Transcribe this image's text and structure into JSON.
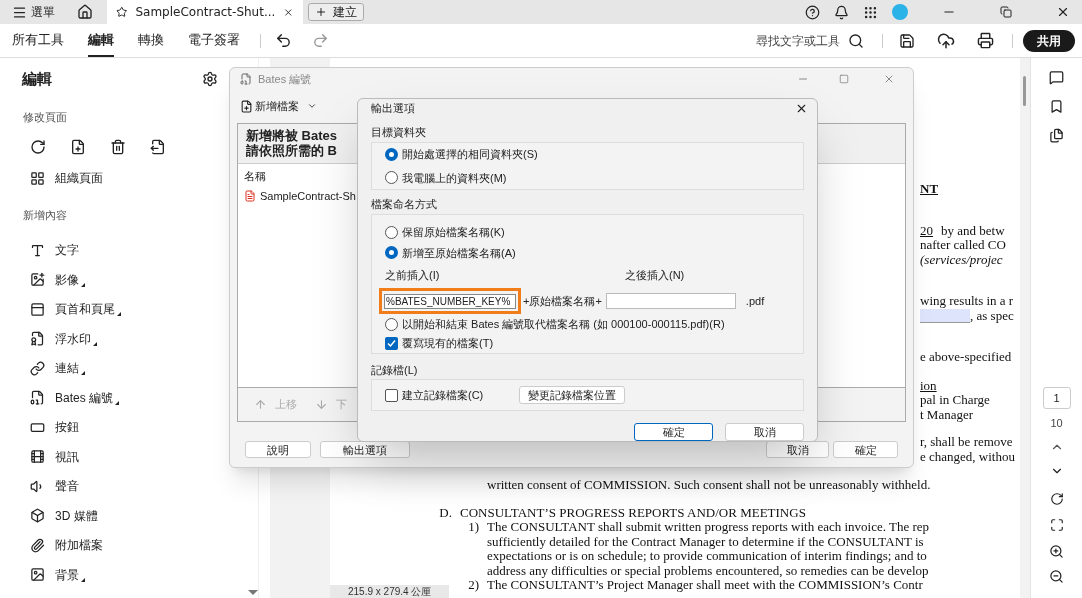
{
  "app_bar": {
    "menu": "選單",
    "tab_title": "SampleContract-Shut...",
    "create": "建立"
  },
  "toolbar": {
    "tabs": [
      {
        "label": "所有工具",
        "selected": false
      },
      {
        "label": "編輯",
        "selected": true
      },
      {
        "label": "轉換",
        "selected": false
      },
      {
        "label": "電子簽署",
        "selected": false
      }
    ],
    "search": "尋找文字或工具",
    "share": "共用"
  },
  "left_panel": {
    "title": "編輯",
    "modify_heading": "修改頁面",
    "organize": "組織頁面",
    "add_heading": "新增內容",
    "items": [
      {
        "label": "文字",
        "has_menu": false
      },
      {
        "label": "影像",
        "has_menu": true
      },
      {
        "label": "頁首和頁尾",
        "has_menu": true
      },
      {
        "label": "浮水印",
        "has_menu": true
      },
      {
        "label": "連結",
        "has_menu": true
      },
      {
        "label": "Bates 編號",
        "has_menu": true
      },
      {
        "label": "按鈕",
        "has_menu": false
      },
      {
        "label": "視訊",
        "has_menu": false
      },
      {
        "label": "聲音",
        "has_menu": false
      },
      {
        "label": "3D 媒體",
        "has_menu": false
      },
      {
        "label": "附加檔案",
        "has_menu": false
      },
      {
        "label": "背景",
        "has_menu": true
      }
    ]
  },
  "document": {
    "fragments": [
      [
        {
          "text": "NT",
          "kind": "heading"
        }
      ],
      [
        {
          "text": "20",
          "kind": "underline"
        },
        {
          "text": "by and betw",
          "kind": "plain"
        }
      ],
      [
        {
          "text": "nafter called CO",
          "kind": "plain"
        }
      ],
      [
        {
          "text": "(services/projec",
          "kind": "italic"
        }
      ],
      [
        {
          "text": "wing results in a r",
          "kind": "plain"
        }
      ],
      [
        {
          "text": ", as spec",
          "kind": "field"
        }
      ],
      [
        {
          "text": "e above-specified",
          "kind": "plain"
        }
      ],
      [
        {
          "text": "ion",
          "kind": "underline"
        }
      ],
      [
        {
          "text": "pal in Charge",
          "kind": "plain"
        }
      ],
      [
        {
          "text": "t Manager",
          "kind": "plain"
        }
      ],
      [
        {
          "text": "r, shall be remove",
          "kind": "plain"
        }
      ],
      [
        {
          "text": "e changed, withou",
          "kind": "plain"
        }
      ]
    ],
    "body": [
      {
        "text": "written consent of COMMISSION.  Such consent shall not be unreasonably withheld."
      },
      {
        "marker": "D.",
        "text": "CONSULTANT’S PROGRESS REPORTS AND/OR MEETINGS"
      },
      {
        "marker": "1)",
        "text": "The CONSULTANT shall submit written progress reports with each invoice. The rep"
      },
      {
        "text": "sufficiently detailed for the Contract Manager to determine if the CONSULTANT is"
      },
      {
        "text": "expectations or is on schedule; to provide communication of interim findings; and to"
      },
      {
        "text": "address any difficulties or special problems encountered, so remedies can be develop"
      },
      {
        "marker": "2)",
        "text": "The CONSULTANT’s Project Manager shall meet with the COMMISSION’s Contr"
      }
    ],
    "page_size": "215.9 x 279.4 公厘"
  },
  "page_nav": {
    "current": "1",
    "total": "10"
  },
  "bates_dialog": {
    "title": "Bates 編號",
    "add_files": "新增檔案",
    "list_heading": [
      "新增將被 Bates",
      "請依照所需的 B"
    ],
    "column": "名稱",
    "files": [
      "SampleContract-Sh"
    ],
    "move": [
      {
        "label": "上移",
        "disabled": true
      },
      {
        "label": "下",
        "disabled": true
      }
    ],
    "help": "說明",
    "output_options": "輸出選項",
    "cancel": "取消",
    "ok": "確定"
  },
  "output_dialog": {
    "title": "輸出選項",
    "target": {
      "label": "目標資料夾",
      "options": [
        {
          "label": "開始處選擇的相同資料夾(S)",
          "selected": true
        },
        {
          "label": "我電腦上的資料夾(M)",
          "selected": false
        }
      ]
    },
    "naming": {
      "label": "檔案命名方式",
      "options": [
        {
          "label": "保留原始檔案名稱(K)",
          "selected": false
        },
        {
          "label": "新增至原始檔案名稱(A)",
          "selected": true
        },
        {
          "label": "以開始和結束 Bates 編號取代檔案名稱 (如 000100-000115.pdf)(R)",
          "selected": false
        }
      ],
      "before_label": "之前插入(I)",
      "before_value": "%BATES_NUMBER_KEY%",
      "middle": "+原始檔案名稱+",
      "after_label": "之後插入(N)",
      "extension": ".pdf",
      "overwrite": {
        "label": "覆寫現有的檔案(T)",
        "checked": true
      }
    },
    "log": {
      "label": "記錄檔(L)",
      "create": {
        "label": "建立記錄檔案(C)",
        "checked": false
      },
      "change_location": "變更記錄檔案位置"
    },
    "ok": "確定",
    "cancel": "取消"
  }
}
